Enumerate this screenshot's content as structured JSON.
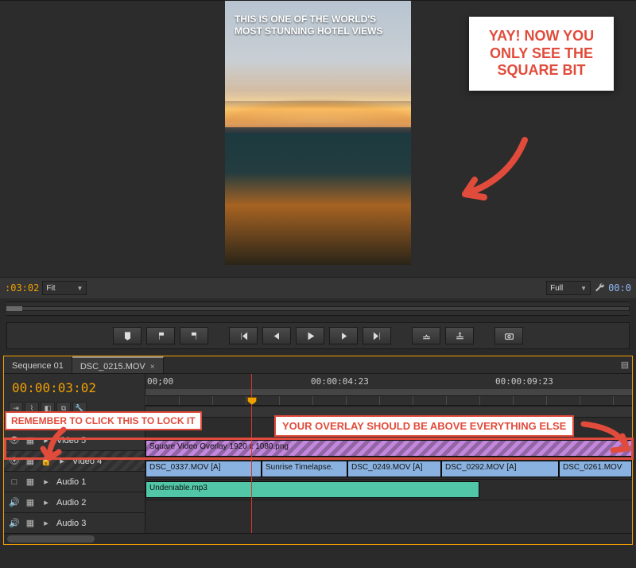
{
  "monitor": {
    "overlay_line1": "THIS IS ONE OF THE WORLD'S",
    "overlay_line2": "MOST STUNNING HOTEL VIEWS",
    "left_tc": ":03:02",
    "zoom_label": "Fit",
    "res_label": "Full",
    "right_tc": "00:0"
  },
  "callouts": {
    "c1": "YAY! NOW YOU ONLY SEE THE SQUARE BIT",
    "lock": "REMEMBER TO CLICK THIS TO LOCK IT",
    "above": "YOUR OVERLAY SHOULD BE ABOVE EVERYTHING ELSE"
  },
  "tabs": {
    "seq": "Sequence 01",
    "clip": "DSC_0215.MOV"
  },
  "timeline": {
    "tc": "00:00:03:02",
    "ruler_tick1": "00;00",
    "ruler_tick2": "00:00:04:23",
    "ruler_tick3": "00:00:09:23"
  },
  "tracks": {
    "v5": "Video 5",
    "v4": "Video 4",
    "a1": "Audio 1",
    "a2": "Audio 2",
    "a3": "Audio 3"
  },
  "clips": {
    "overlay": "Square Video Overlay 1920 x 1080.png",
    "a1_1": "DSC_0337.MOV [A]",
    "a1_2": "Sunrise Timelapse.",
    "a1_3": "DSC_0249.MOV [A]",
    "a1_4": "DSC_0292.MOV [A]",
    "a1_5": "DSC_0261.MOV",
    "a2_1": "Undeniable.mp3"
  }
}
